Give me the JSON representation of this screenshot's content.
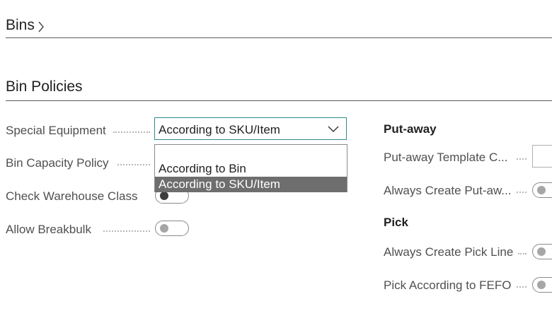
{
  "breadcrumb": {
    "label": "Bins"
  },
  "section": {
    "title": "Bin Policies"
  },
  "fields": {
    "special_equipment": {
      "label": "Special Equipment",
      "value": "According to SKU/Item"
    },
    "bin_capacity_policy": {
      "label": "Bin Capacity Policy"
    },
    "check_warehouse_class": {
      "label": "Check Warehouse Class",
      "on": false
    },
    "allow_breakbulk": {
      "label": "Allow Breakbulk",
      "on": false
    }
  },
  "dropdown": {
    "options": [
      "According to Bin",
      "According to SKU/Item"
    ],
    "selected": "According to SKU/Item"
  },
  "putaway": {
    "title": "Put-away",
    "template_label": "Put-away Template C...",
    "always_create_label": "Always Create Put-aw..."
  },
  "pick": {
    "title": "Pick",
    "always_create_label": "Always Create Pick Line",
    "fefo_label": "Pick According to FEFO"
  },
  "colors": {
    "accent": "#2e8b8b",
    "selected_option_bg": "#6e6e6e"
  }
}
